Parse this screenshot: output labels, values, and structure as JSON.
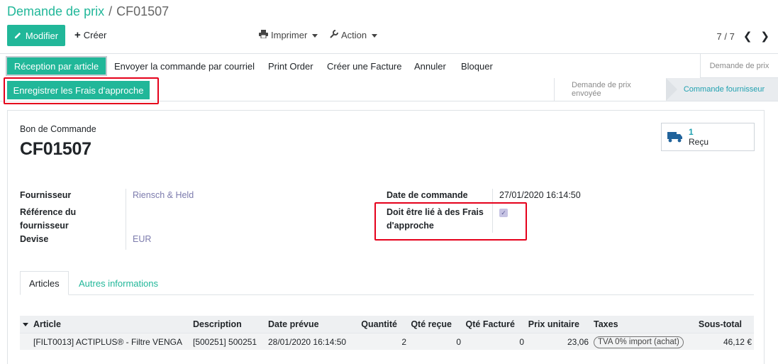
{
  "breadcrumb": {
    "parent": "Demande de prix",
    "separator": "/",
    "current": "CF01507"
  },
  "toolbar": {
    "edit_label": "Modifier",
    "create_label": "Créer",
    "print_label": "Imprimer",
    "action_label": "Action"
  },
  "pager": {
    "value": "7 / 7"
  },
  "actions": {
    "reception": "Réception par article",
    "send_email": "Envoyer la commande par courriel",
    "print_order": "Print Order",
    "create_invoice": "Créer une Facture",
    "cancel": "Annuler",
    "block": "Bloquer",
    "landed_costs": "Enregistrer les Frais d'approche"
  },
  "stages": {
    "top": "Demande de prix",
    "sent": "Demande de prix envoyée",
    "current": "Commande fournisseur"
  },
  "form": {
    "doc_type": "Bon de Commande",
    "doc_name": "CF01507",
    "smart_button": {
      "count": "1",
      "label": "Reçu"
    },
    "supplier_label": "Fournisseur",
    "supplier_value": "Riensch & Held",
    "ref_label_line1": "Référence du",
    "ref_label_line2": "fournisseur",
    "currency_label": "Devise",
    "currency_value": "EUR",
    "order_date_label": "Date de commande",
    "order_date_value": "27/01/2020 16:14:50",
    "landed_label_line1": "Doit être lié à des Frais",
    "landed_label_line2": "d'approche",
    "landed_checked": true
  },
  "tabs": [
    {
      "label": "Articles"
    },
    {
      "label": "Autres informations"
    }
  ],
  "table": {
    "headers": {
      "article": "Article",
      "description": "Description",
      "date": "Date prévue",
      "qty": "Quantité",
      "qty_received": "Qté reçue",
      "qty_invoiced": "Qté Facturé",
      "unit_price": "Prix unitaire",
      "taxes": "Taxes",
      "subtotal": "Sous-total"
    },
    "rows": [
      {
        "article": "[FILT0013] ACTIPLUS® - Filtre VENGA",
        "description": "[500251] 500251",
        "date": "28/01/2020 16:14:50",
        "qty": "2",
        "qty_received": "0",
        "qty_invoiced": "0",
        "unit_price": "23,06",
        "taxes": "TVA 0% import (achat)",
        "subtotal": "46,12 €"
      }
    ]
  },
  "colors": {
    "primary": "#21b799",
    "link": "#7c7bad",
    "highlight": "#e5001b"
  }
}
